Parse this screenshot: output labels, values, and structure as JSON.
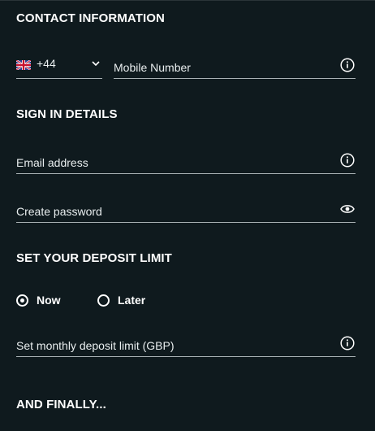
{
  "sections": {
    "contact": "CONTACT INFORMATION",
    "signin": "SIGN IN DETAILS",
    "deposit": "SET YOUR DEPOSIT LIMIT",
    "finally": "AND FINALLY..."
  },
  "phone": {
    "country_code": "+44",
    "flag_icon": "uk-flag-icon",
    "placeholder": "Mobile Number"
  },
  "email": {
    "placeholder": "Email address"
  },
  "password": {
    "placeholder": "Create password"
  },
  "deposit_limit": {
    "options": [
      "Now",
      "Later"
    ],
    "selected": "Now",
    "placeholder": "Set monthly deposit limit (GBP)"
  },
  "icons": {
    "info": "info-icon",
    "eye": "eye-icon",
    "chevron": "chevron-down-icon"
  },
  "colors": {
    "background": "#0f1a1e",
    "text": "#ffffff",
    "underline": "#a8b0b3"
  }
}
